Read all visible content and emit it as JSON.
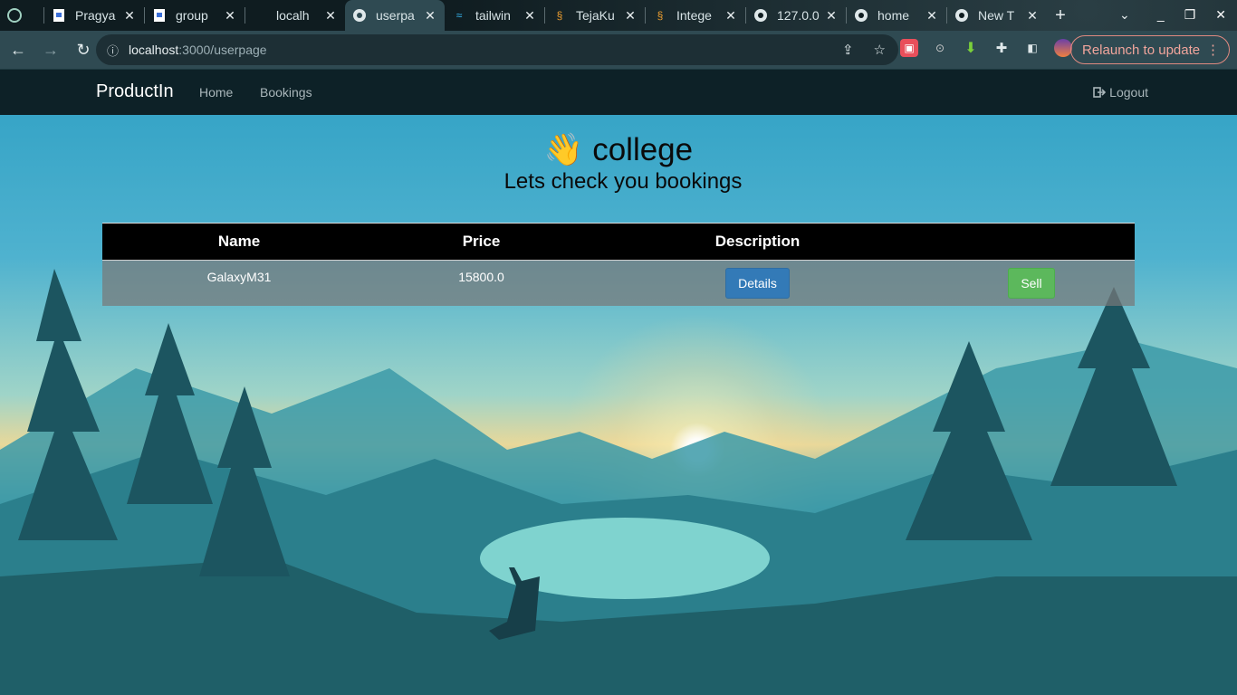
{
  "browser": {
    "tabs": [
      {
        "title": "",
        "icon": "chatgpt-icon"
      },
      {
        "title": "Pragya",
        "icon": "doc-icon"
      },
      {
        "title": "group",
        "icon": "doc-icon"
      },
      {
        "title": "localh",
        "icon": ""
      },
      {
        "title": "userpa",
        "icon": "globe-icon",
        "active": true
      },
      {
        "title": "tailwin",
        "icon": "tailwind-icon"
      },
      {
        "title": "TejaKu",
        "icon": "hackerrank-icon"
      },
      {
        "title": "Intege",
        "icon": "hackerrank-icon"
      },
      {
        "title": "127.0.0",
        "icon": "globe-icon"
      },
      {
        "title": "home",
        "icon": "globe-icon"
      },
      {
        "title": "New T",
        "icon": "chrome-icon"
      }
    ],
    "url_host": "localhost",
    "url_path": ":3000/userpage",
    "relaunch_label": "Relaunch to update"
  },
  "nav": {
    "brand": "ProductIn",
    "links": [
      "Home",
      "Bookings"
    ],
    "logout": "Logout"
  },
  "main": {
    "wave_emoji": "👋",
    "greeting": "college",
    "subtitle": "Lets check you bookings"
  },
  "table": {
    "headers": [
      "Name",
      "Price",
      "Description",
      ""
    ],
    "rows": [
      {
        "name": "GalaxyM31",
        "price": "15800.0",
        "details_label": "Details",
        "sell_label": "Sell"
      }
    ]
  },
  "colors": {
    "navbar": "#0d2127",
    "details_button": "#337ab7",
    "sell_button": "#5cb85c"
  }
}
